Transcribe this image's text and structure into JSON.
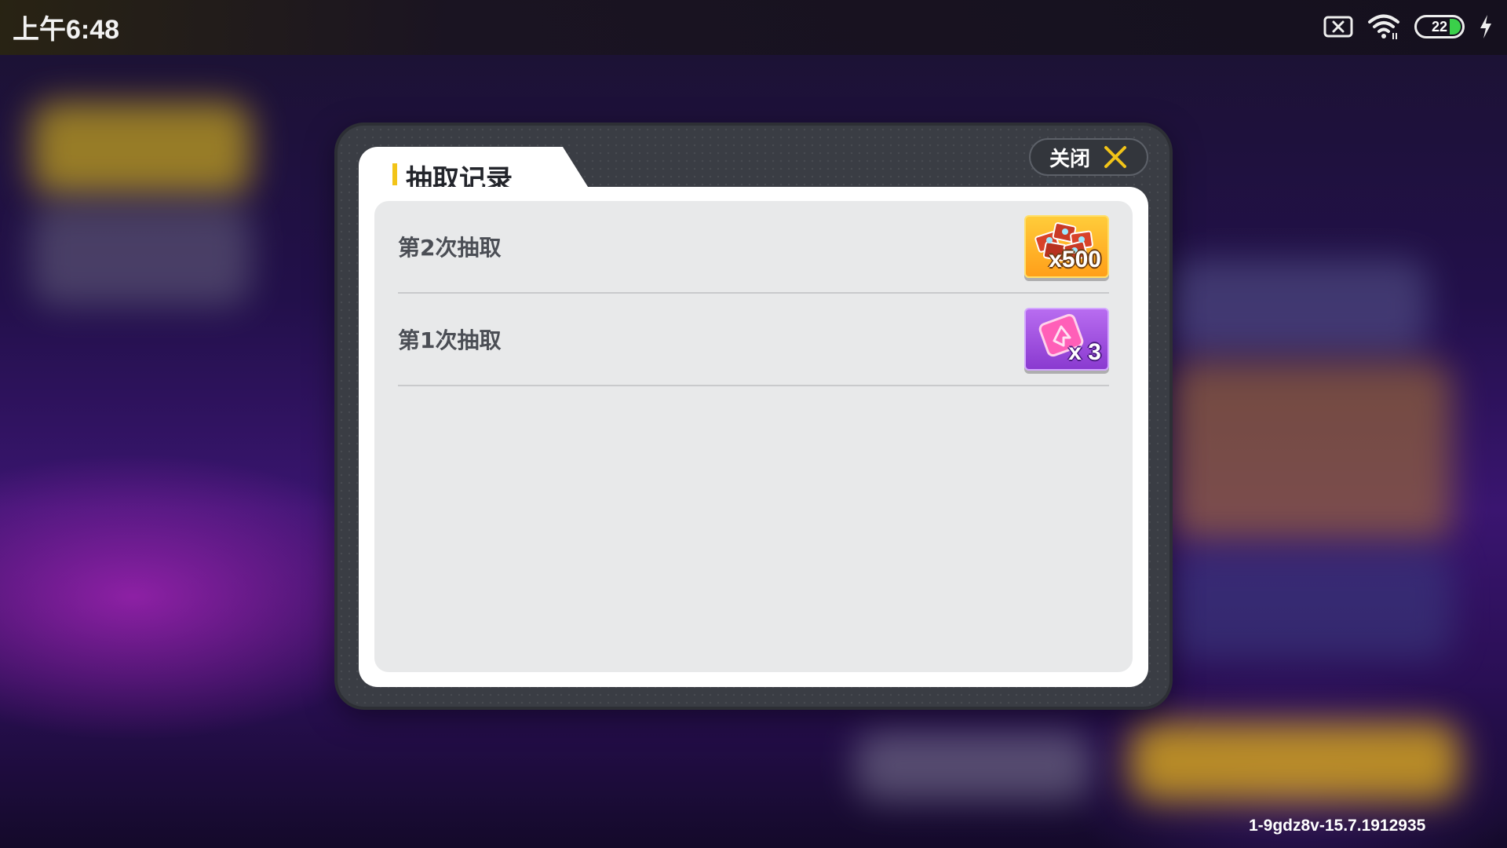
{
  "status_bar": {
    "time": "上午6:48",
    "battery_level": "22",
    "icons": [
      "no-sim-icon",
      "wifi-icon",
      "battery-icon",
      "charging-icon"
    ]
  },
  "dialog": {
    "title": "抽取记录",
    "close_label": "关闭",
    "close_icon": "close-icon",
    "records": [
      {
        "label": "第2次抽取",
        "reward_icon": "gem-pile-icon",
        "quantity": "x500",
        "color": "#ffb12a"
      },
      {
        "label": "第1次抽取",
        "reward_icon": "card-ticket-icon",
        "quantity": "x 3",
        "color": "#9a4de0"
      }
    ]
  },
  "footer": {
    "version": "1-9gdz8v-15.7.1912935"
  },
  "colors": {
    "accent_yellow": "#f2c418",
    "dialog_frame": "#3a3d44",
    "panel": "#e8e9ea"
  }
}
